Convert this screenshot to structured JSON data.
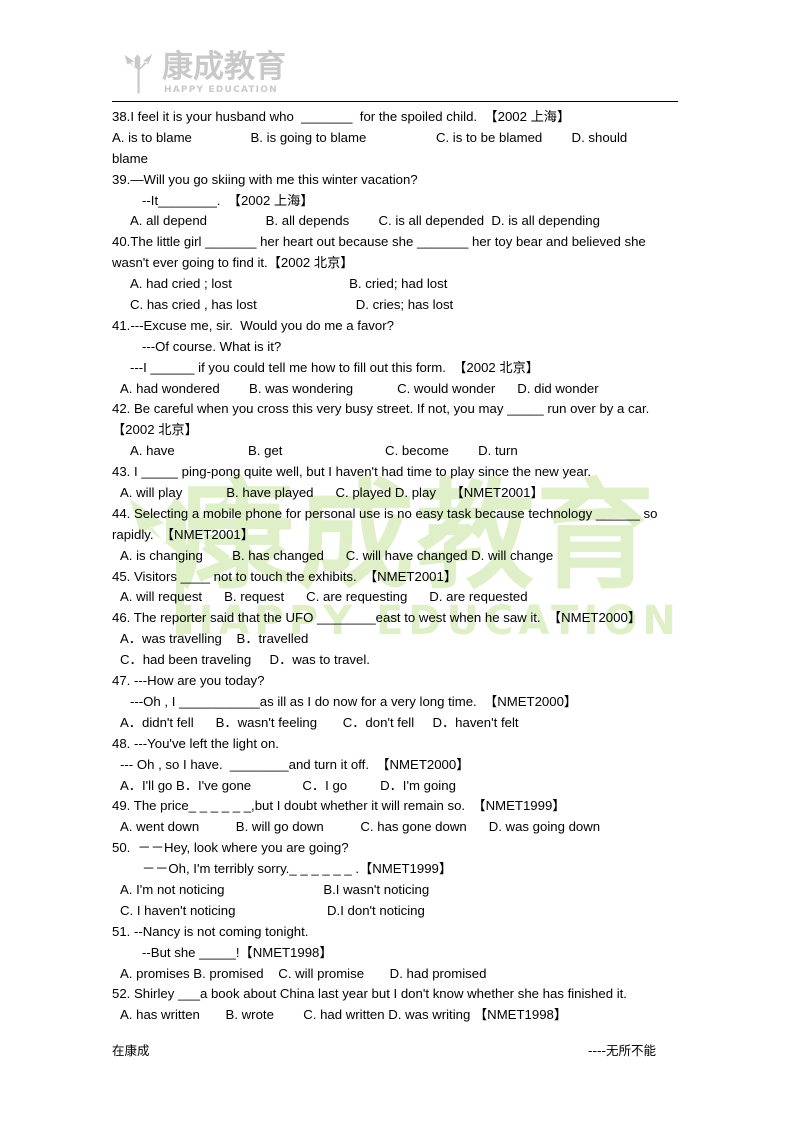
{
  "header": {
    "logo_cn": "康成教育",
    "logo_en": "HAPPY EDUCATION"
  },
  "watermark": {
    "cn": "康成教育",
    "en": "HAPPY EDUCATION",
    "color": "#dff0c8"
  },
  "footer": {
    "left": "在康成",
    "right": "----无所不能"
  },
  "lines": [
    "38.I feel it is your husband who  _______  for the spoiled child.  【2002 上海】",
    "A. is to blame                B. is going to blame                   C. is to be blamed        D. should",
    "blame",
    "39.—Will you go skiing with me this winter vacation?",
    "--It________.  【2002 上海】",
    "A. all depend                B. all depends        C. is all depended  D. is all depending",
    "40.The little girl _______ her heart out because she _______ her toy bear and believed she",
    "wasn't ever going to find it.【2002 北京】",
    "A. had cried ; lost                                B. cried; had lost",
    "C. has cried , has lost                           D. cries; has lost",
    "41.---Excuse me, sir.  Would you do me a favor?",
    "---Of course. What is it?",
    "---I ______ if you could tell me how to fill out this form.  【2002 北京】",
    "A. had wondered        B. was wondering            C. would wonder      D. did wonder",
    "42. Be careful when you cross this very busy street. If not, you may _____ run over by a car.",
    "【2002 北京】",
    "A. have                    B. get                            C. become        D. turn",
    "43. I _____ ping-pong quite well, but I haven't had time to play since the new year.",
    "A. will play            B. have played      C. played D. play    【NMET2001】",
    "44. Selecting a mobile phone for personal use is no easy task because technology ______ so",
    "rapidly.  【NMET2001】",
    "A. is changing        B. has changed      C. will have changed D. will change",
    "45. Visitors ____ not to touch the exhibits.  【NMET2001】",
    "A. will request      B. request      C. are requesting      D. are requested",
    "46. The reporter said that the UFO ________east to west when he saw it.  【NMET2000】",
    "A．was travelling    B．travelled",
    "C．had been traveling     D．was to travel.",
    "47. ---How are you today?",
    "---Oh , I ___________as ill as I do now for a very long time.  【NMET2000】",
    "A．didn't fell      B．wasn't feeling       C．don't fell     D．haven't felt",
    "48. ---You've left the light on.",
    "--- Oh , so I have.  ________and turn it off.  【NMET2000】",
    "A．I'll go B．I've gone              C．I go         D．I'm going",
    "49. The price_ _ _ _ _ _,but I doubt whether it will remain so.  【NMET1999】",
    "A. went down          B. will go down          C. has gone down      D. was going down",
    "50.  －－Hey, look where you are going?",
    "－－Oh, I'm terribly sorry._ _ _ _ _ _ .【NMET1999】",
    "A. I'm not noticing                           B.I wasn't noticing",
    "C. I haven't noticing                         D.I don't noticing",
    "51. --Nancy is not coming tonight.",
    "--But she _____!【NMET1998】",
    "A. promises B. promised    C. will promise       D. had promised",
    "52. Shirley ___a book about China last year but I don't know whether she has finished it.",
    "A. has written       B. wrote        C. had written D. was writing 【NMET1998】"
  ],
  "indents": [
    0,
    0,
    0,
    0,
    3,
    2,
    0,
    0,
    2,
    2,
    0,
    3,
    2,
    1,
    0,
    0,
    2,
    0,
    1,
    0,
    0,
    1,
    0,
    1,
    0,
    1,
    1,
    0,
    2,
    1,
    0,
    1,
    1,
    0,
    1,
    0,
    3,
    1,
    1,
    0,
    3,
    1,
    0,
    1
  ]
}
